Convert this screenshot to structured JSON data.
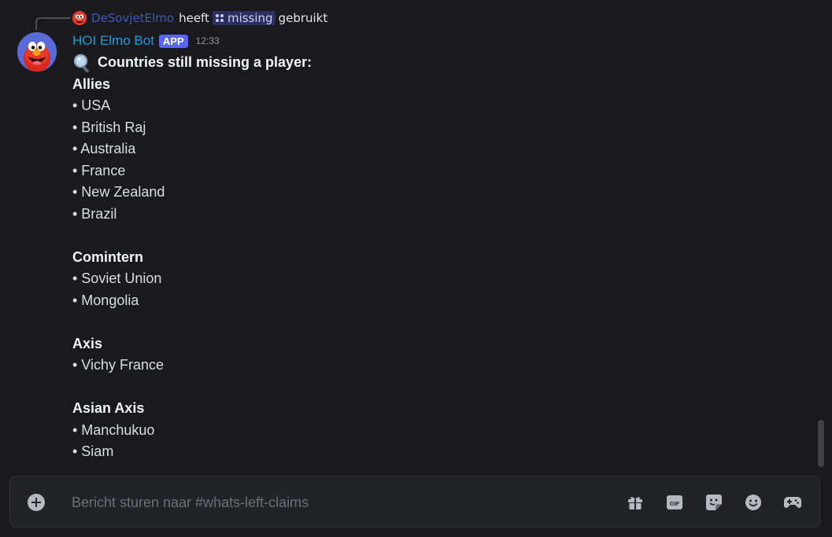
{
  "reply": {
    "user": "DeSovjetElmo",
    "action_before": "heeft",
    "command": "missing",
    "action_after": "gebruikt"
  },
  "message": {
    "username": "HOI Elmo Bot",
    "tag": "APP",
    "timestamp": "12:33",
    "heading": "Countries still missing a player:",
    "groups": [
      {
        "title": "Allies",
        "items": [
          "• USA",
          "• British Raj",
          "• Australia",
          "• France",
          "• New Zealand",
          "• Brazil"
        ]
      },
      {
        "title": "Comintern",
        "items": [
          "• Soviet Union",
          "• Mongolia"
        ]
      },
      {
        "title": "Axis",
        "items": [
          "• Vichy France"
        ]
      },
      {
        "title": "Asian Axis",
        "items": [
          "• Manchukuo",
          "• Siam"
        ]
      }
    ]
  },
  "composer": {
    "placeholder": "Bericht sturen naar #whats-left-claims",
    "value": ""
  },
  "toolbar": {
    "gif_label": "GIF"
  },
  "icons": {
    "add": "plus-circle-icon",
    "gift": "gift-icon",
    "gif": "gif-icon",
    "sticker": "sticker-icon",
    "emoji": "emoji-icon",
    "activities": "gamepad-icon",
    "heading": "magnifying-glass-icon"
  },
  "colors": {
    "background": "#1a1a1e",
    "username": "#1e9bd7",
    "app_tag": "#5865f2",
    "reply_user": "#3b5bb5"
  }
}
